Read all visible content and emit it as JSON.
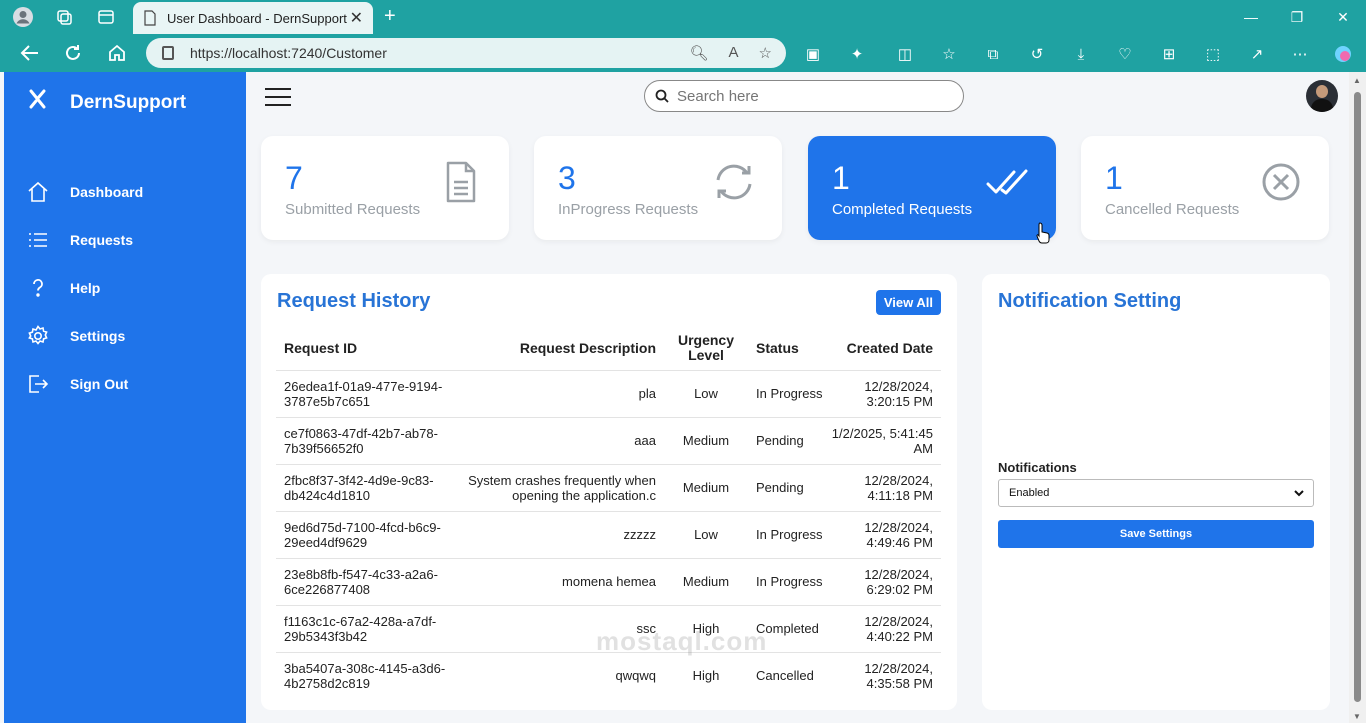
{
  "browser": {
    "tab_title": "User Dashboard - DernSupport",
    "url": "https://localhost:7240/Customer"
  },
  "sidebar": {
    "brand": "DernSupport",
    "items": [
      {
        "label": "Dashboard",
        "icon": "home-icon"
      },
      {
        "label": "Requests",
        "icon": "list-icon"
      },
      {
        "label": "Help",
        "icon": "question-icon"
      },
      {
        "label": "Settings",
        "icon": "gear-icon"
      },
      {
        "label": "Sign Out",
        "icon": "sign-out-icon"
      }
    ]
  },
  "header": {
    "search_placeholder": "Search here"
  },
  "cards": [
    {
      "count": "7",
      "label": "Submitted Requests",
      "icon": "document-icon"
    },
    {
      "count": "3",
      "label": "InProgress Requests",
      "icon": "refresh-icon"
    },
    {
      "count": "1",
      "label": "Completed Requests",
      "icon": "double-check-icon"
    },
    {
      "count": "1",
      "label": "Cancelled Requests",
      "icon": "cancel-circle-icon"
    }
  ],
  "history": {
    "title": "Request History",
    "view_all": "View All",
    "columns": [
      "Request ID",
      "Request Description",
      "Urgency Level",
      "Status",
      "Created Date"
    ],
    "rows": [
      {
        "id": "26edea1f-01a9-477e-9194-3787e5b7c651",
        "desc": "pla",
        "urgency": "Low",
        "status": "In Progress",
        "date": "12/28/2024, 3:20:15 PM"
      },
      {
        "id": "ce7f0863-47df-42b7-ab78-7b39f56652f0",
        "desc": "aaa",
        "urgency": "Medium",
        "status": "Pending",
        "date": "1/2/2025, 5:41:45 AM"
      },
      {
        "id": "2fbc8f37-3f42-4d9e-9c83-db424c4d1810",
        "desc": "System crashes frequently when opening the application.c",
        "urgency": "Medium",
        "status": "Pending",
        "date": "12/28/2024, 4:11:18 PM"
      },
      {
        "id": "9ed6d75d-7100-4fcd-b6c9-29eed4df9629",
        "desc": "zzzzz",
        "urgency": "Low",
        "status": "In Progress",
        "date": "12/28/2024, 4:49:46 PM"
      },
      {
        "id": "23e8b8fb-f547-4c33-a2a6-6ce226877408",
        "desc": "momena hemea",
        "urgency": "Medium",
        "status": "In Progress",
        "date": "12/28/2024, 6:29:02 PM"
      },
      {
        "id": "f1163c1c-67a2-428a-a7df-29b5343f3b42",
        "desc": "ssc",
        "urgency": "High",
        "status": "Completed",
        "date": "12/28/2024, 4:40:22 PM"
      },
      {
        "id": "3ba5407a-308c-4145-a3d6-4b2758d2c819",
        "desc": "qwqwq",
        "urgency": "High",
        "status": "Cancelled",
        "date": "12/28/2024, 4:35:58 PM"
      }
    ]
  },
  "notifications": {
    "title": "Notification Setting",
    "field_label": "Notifications",
    "selected": "Enabled",
    "save_label": "Save Settings"
  },
  "watermark": "mostaql.com",
  "colors": {
    "primary": "#1f74ea",
    "chrome": "#1fa2a2",
    "title": "#2874d6"
  }
}
